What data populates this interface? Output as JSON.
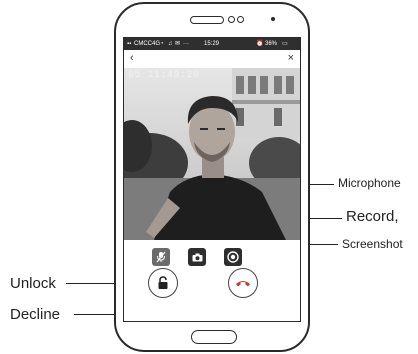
{
  "status_bar": {
    "carrier": "CMCC4G",
    "time": "15:29",
    "battery": "36%",
    "icons": [
      "signal-icon",
      "wifi-icon",
      "music-icon",
      "mail-icon",
      "alarm-icon",
      "battery-icon"
    ]
  },
  "nav": {
    "back_icon": "‹",
    "close_icon": "×"
  },
  "video": {
    "timestamp": "05 11:49:20"
  },
  "controls": {
    "mic_icon": "microphone-muted-icon",
    "screenshot_icon": "camera-icon",
    "record_icon": "record-icon"
  },
  "actions": {
    "unlock_icon": "lock-icon",
    "decline_icon": "hangup-icon"
  },
  "callouts": {
    "microphone": "Microphone",
    "record": "Record,",
    "screenshot": "Screenshot",
    "unlock": "Unlock",
    "decline": "Decline"
  },
  "colors": {
    "status_bar": "#2f2f2f",
    "phone_outline": "#2b2b2b",
    "decline_red": "#c23a3a"
  }
}
